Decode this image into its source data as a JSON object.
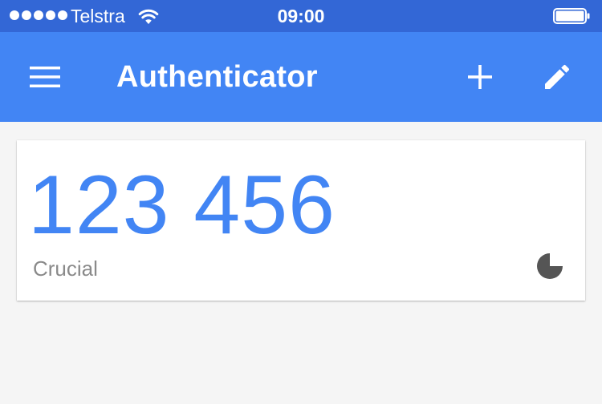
{
  "status_bar": {
    "carrier": "Telstra",
    "time": "09:00",
    "signal_bars": 5
  },
  "app_bar": {
    "title": "Authenticator",
    "icons": {
      "menu": "menu-icon",
      "add": "plus-icon",
      "edit": "pencil-icon"
    }
  },
  "accounts": [
    {
      "code": "123 456",
      "name": "Crucial",
      "timer_remaining_fraction": 0.75,
      "timer_icon": "countdown-pie-icon"
    }
  ],
  "colors": {
    "status_bar": "#3367d6",
    "app_bar": "#4285f4",
    "background": "#f5f5f5",
    "code": "#4285f4",
    "account_name": "#8a8a8a",
    "timer": "#555555"
  }
}
